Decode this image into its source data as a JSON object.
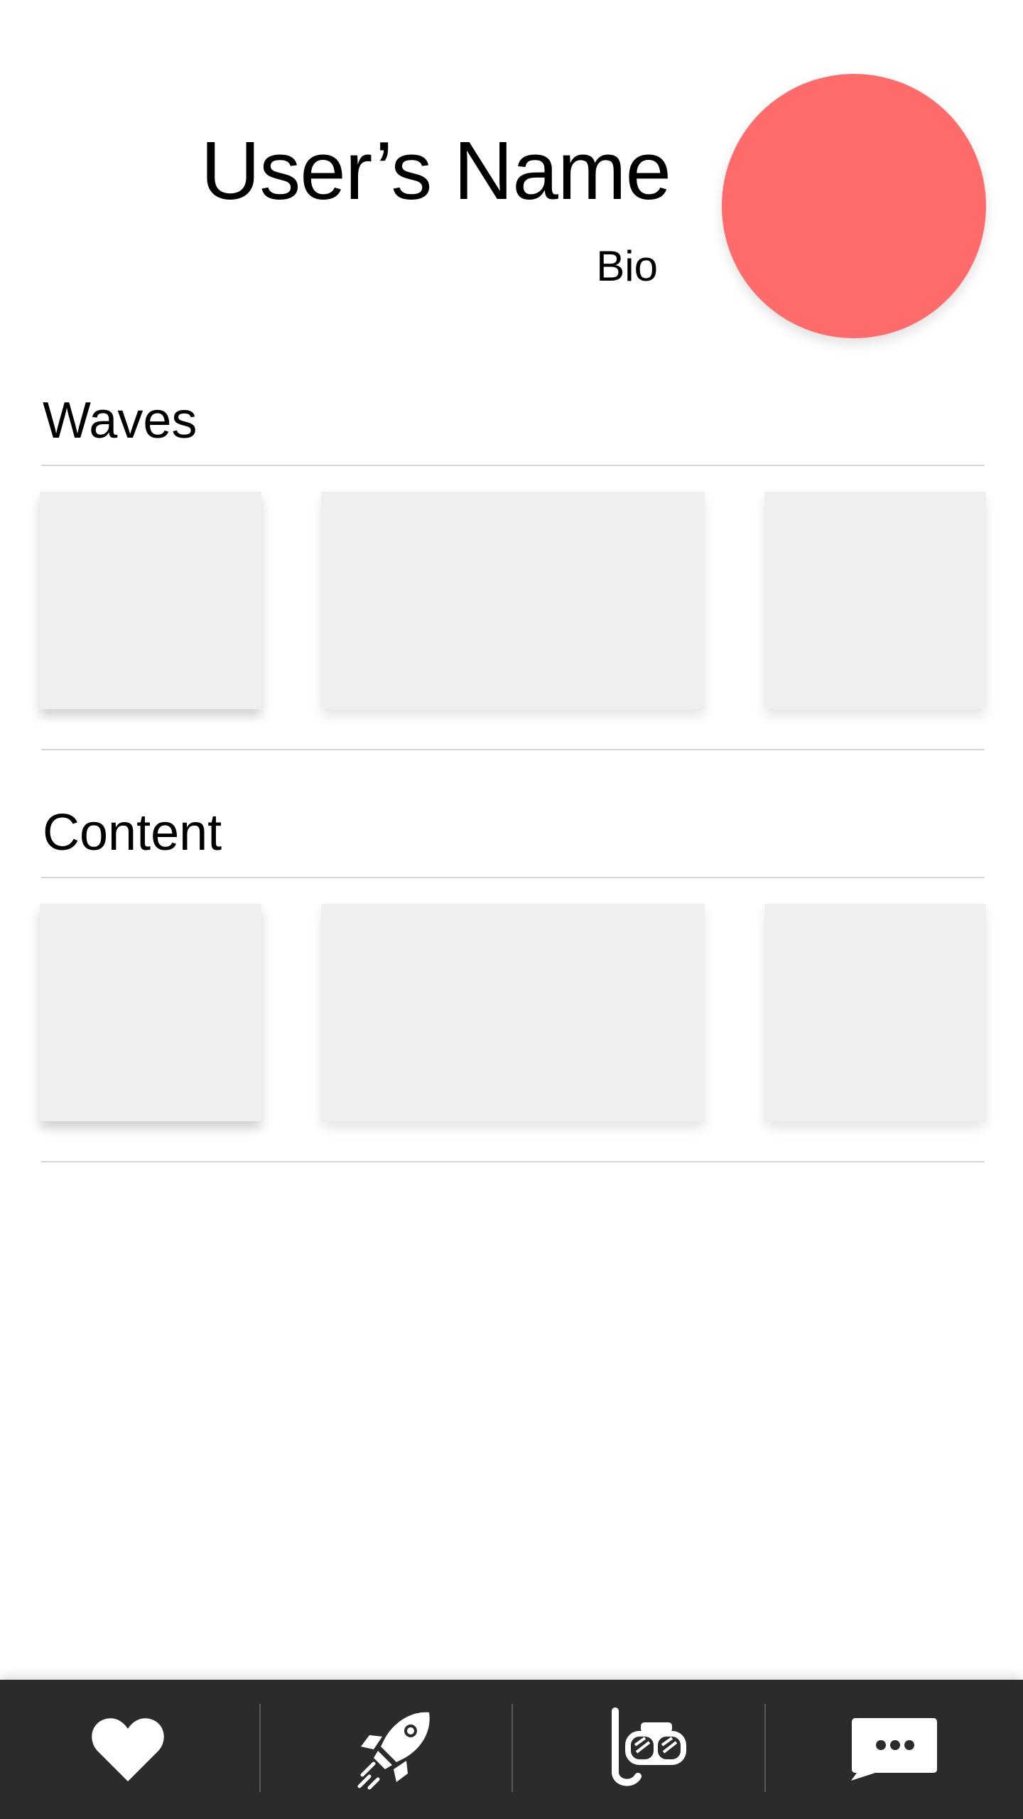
{
  "profile": {
    "name": "User’s Name",
    "bio": "Bio",
    "avatar_color": "#ff6b6b"
  },
  "sections": [
    {
      "title": "Waves"
    },
    {
      "title": "Content"
    }
  ],
  "navbar": {
    "background": "#2b2b2b",
    "items": [
      {
        "icon": "heart-icon"
      },
      {
        "icon": "rocket-icon"
      },
      {
        "icon": "snorkel-mask-icon"
      },
      {
        "icon": "chat-bubble-icon"
      }
    ]
  }
}
